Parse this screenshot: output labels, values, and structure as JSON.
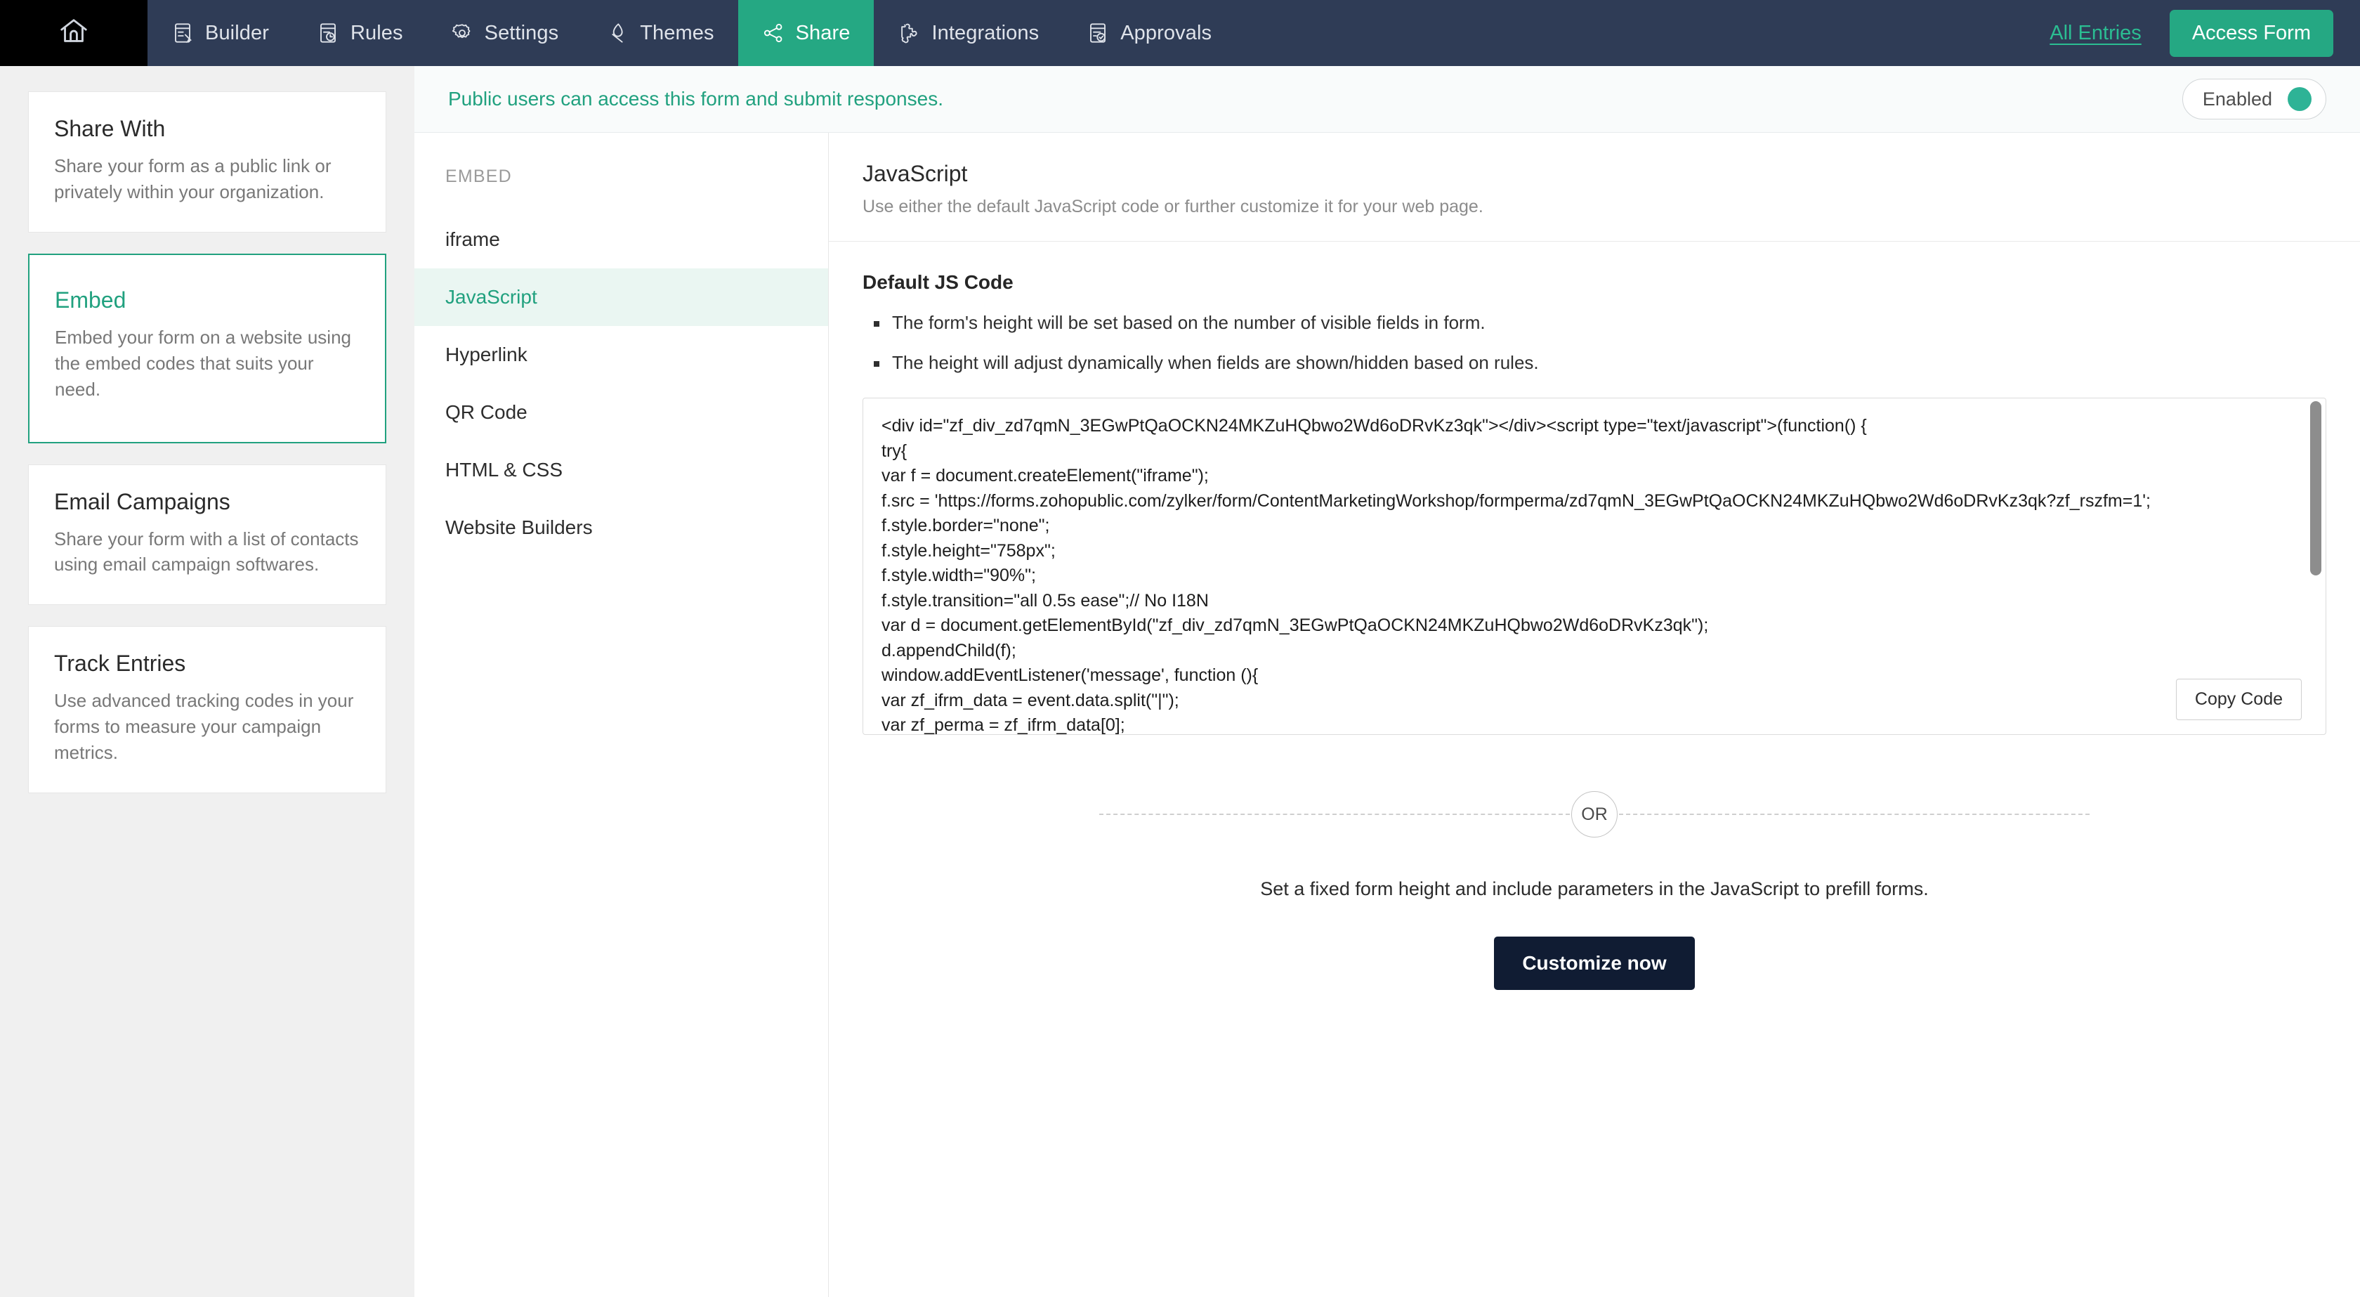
{
  "topnav": {
    "home_icon": "home-icon",
    "items": [
      {
        "label": "Builder",
        "icon": "builder-icon",
        "active": false
      },
      {
        "label": "Rules",
        "icon": "rules-icon",
        "active": false
      },
      {
        "label": "Settings",
        "icon": "gear-icon",
        "active": false
      },
      {
        "label": "Themes",
        "icon": "themes-icon",
        "active": false
      },
      {
        "label": "Share",
        "icon": "share-icon",
        "active": true
      },
      {
        "label": "Integrations",
        "icon": "puzzle-icon",
        "active": false
      },
      {
        "label": "Approvals",
        "icon": "approvals-icon",
        "active": false
      }
    ],
    "all_entries_label": "All Entries",
    "access_form_label": "Access Form",
    "accent_green": "#25a883",
    "nav_bg": "#2f3c56"
  },
  "notice": {
    "text": "Public users can access this form and submit responses.",
    "toggle_label": "Enabled",
    "toggle_state_color": "#2eb396"
  },
  "sidebar": {
    "cards": [
      {
        "title": "Share With",
        "desc": "Share your form as a public link or privately within your organization.",
        "active": false
      },
      {
        "title": "Embed",
        "desc": "Embed your form on a website using the embed codes that suits your need.",
        "active": true
      },
      {
        "title": "Email Campaigns",
        "desc": "Share your form with a list of contacts using email campaign softwares.",
        "active": false
      },
      {
        "title": "Track Entries",
        "desc": "Use advanced tracking codes in your forms to measure your campaign metrics.",
        "active": false
      }
    ]
  },
  "embed_list": {
    "heading": "EMBED",
    "items": [
      {
        "label": "iframe",
        "active": false
      },
      {
        "label": "JavaScript",
        "active": true
      },
      {
        "label": "Hyperlink",
        "active": false
      },
      {
        "label": "QR Code",
        "active": false
      },
      {
        "label": "HTML & CSS",
        "active": false
      },
      {
        "label": "Website Builders",
        "active": false
      }
    ]
  },
  "main": {
    "title": "JavaScript",
    "subtitle": "Use either the default JavaScript code or further customize it for your web page.",
    "section_title": "Default JS Code",
    "bullets": [
      "The form's height will be set based on the number of visible fields in form.",
      "The height will adjust dynamically when fields are shown/hidden based on rules."
    ],
    "code": "<div id=\"zf_div_zd7qmN_3EGwPtQaOCKN24MKZuHQbwo2Wd6oDRvKz3qk\"></div><script type=\"text/javascript\">(function() {\ntry{\nvar f = document.createElement(\"iframe\");\nf.src = 'https://forms.zohopublic.com/zylker/form/ContentMarketingWorkshop/formperma/zd7qmN_3EGwPtQaOCKN24MKZuHQbwo2Wd6oDRvKz3qk?zf_rszfm=1';\nf.style.border=\"none\";\nf.style.height=\"758px\";\nf.style.width=\"90%\";\nf.style.transition=\"all 0.5s ease\";// No I18N\nvar d = document.getElementById(\"zf_div_zd7qmN_3EGwPtQaOCKN24MKZuHQbwo2Wd6oDRvKz3qk\");\nd.appendChild(f);\nwindow.addEventListener('message', function (){\nvar zf_ifrm_data = event.data.split(\"|\");\nvar zf_perma = zf_ifrm_data[0];",
    "copy_code_label": "Copy Code",
    "or_label": "OR",
    "prefill_text": "Set a fixed form height and include parameters in the JavaScript to prefill forms.",
    "customize_label": "Customize now"
  }
}
